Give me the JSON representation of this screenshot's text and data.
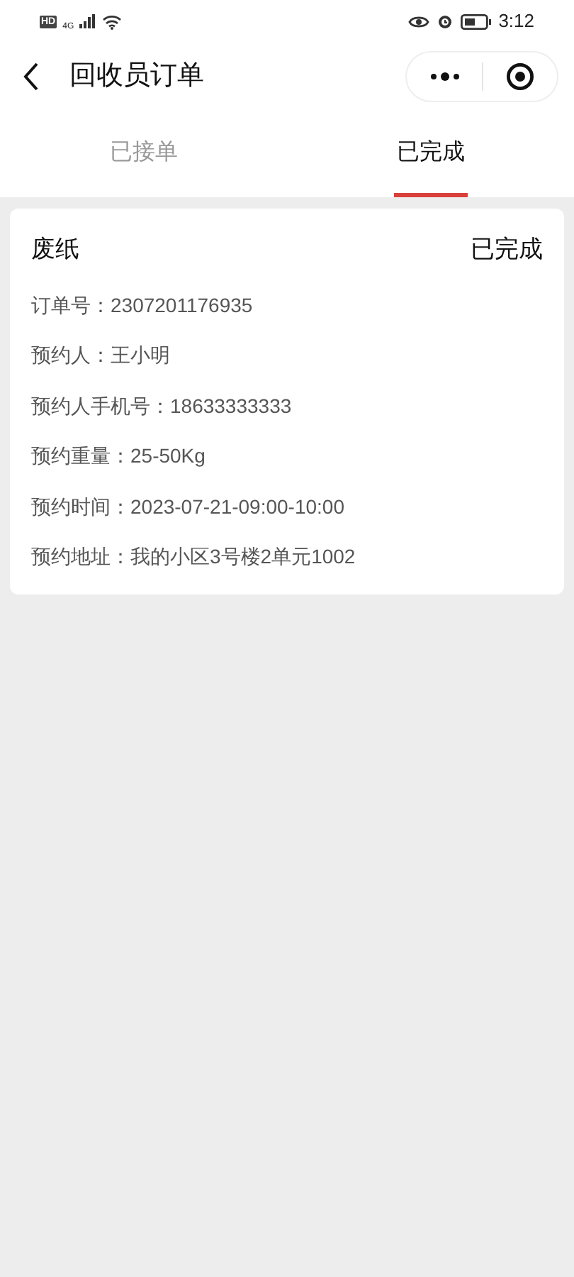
{
  "status_bar": {
    "hd": "HD",
    "network": "4G",
    "time": "3:12"
  },
  "header": {
    "title": "回收员订单"
  },
  "tabs": [
    {
      "label": "已接单",
      "selected": false
    },
    {
      "label": "已完成",
      "selected": true
    }
  ],
  "orders": [
    {
      "title": "废纸",
      "status": "已完成",
      "fields": [
        "订单号：2307201176935",
        "预约人：王小明",
        "预约人手机号：18633333333",
        "预约重量：25-50Kg",
        "预约时间：2023-07-21-09:00-10:00",
        "预约地址：我的小区3号楼2单元1002"
      ]
    }
  ]
}
